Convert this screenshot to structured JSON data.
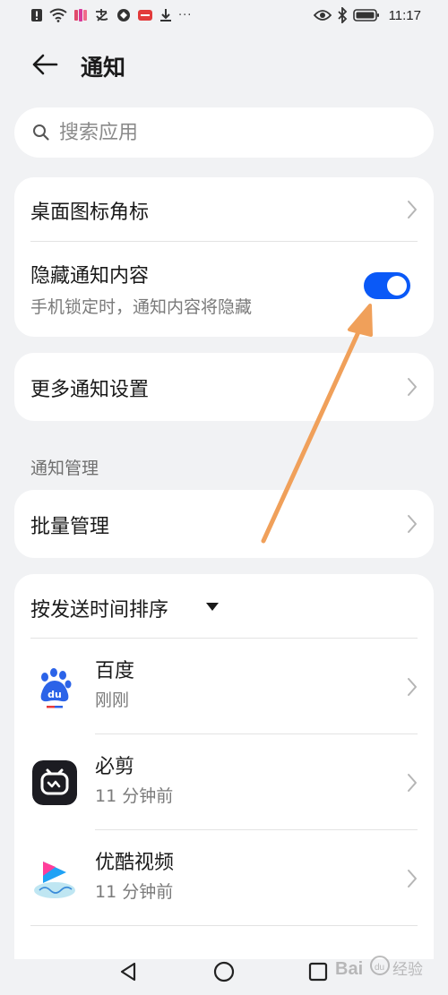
{
  "status_bar": {
    "time": "11:17",
    "overflow": "···",
    "left_icons": [
      "alert-icon",
      "wifi-icon",
      "app-notification-icon",
      "alipay-icon",
      "app-icon",
      "app-icon",
      "download-icon"
    ],
    "right_icons": [
      "eye-icon",
      "bluetooth-icon",
      "battery-icon"
    ]
  },
  "header": {
    "back_icon": "arrow-left-icon",
    "title": "通知"
  },
  "search": {
    "placeholder": "搜索应用",
    "icon": "search-icon"
  },
  "settings_card": {
    "badge_row": {
      "label": "桌面图标角标"
    },
    "hide_content_row": {
      "label": "隐藏通知内容",
      "sublabel": "手机锁定时，通知内容将隐藏",
      "toggle_on": true
    }
  },
  "more_settings": {
    "label": "更多通知设置"
  },
  "management": {
    "section_title": "通知管理",
    "batch_label": "批量管理"
  },
  "app_list": {
    "sort_label": "按发送时间排序",
    "apps": [
      {
        "name": "百度",
        "time": "刚刚",
        "icon": "baidu-paw-icon"
      },
      {
        "name": "必剪",
        "time": "11 分钟前",
        "icon": "bijian-icon"
      },
      {
        "name": "优酷视频",
        "time": "11 分钟前",
        "icon": "youku-icon"
      }
    ]
  },
  "nav_bar": {
    "buttons": [
      "back-triangle-icon",
      "home-circle-icon",
      "recents-square-icon"
    ]
  },
  "watermark": {
    "text": "Bai 经验"
  },
  "colors": {
    "accent": "#0a59f7",
    "annotation_arrow": "#f0a05a",
    "background": "#f1f2f4"
  }
}
